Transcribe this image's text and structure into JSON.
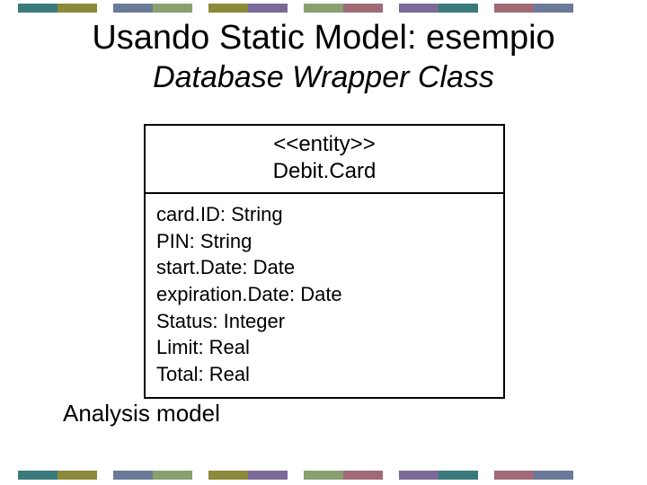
{
  "title": "Usando Static Model: esempio",
  "subtitle": "Database Wrapper Class",
  "uml": {
    "stereotype": "<<entity>>",
    "name": "Debit.Card",
    "attributes": [
      "card.ID: String",
      "PIN: String",
      "start.Date: Date",
      "expiration.Date: Date",
      "Status: Integer",
      "Limit: Real",
      "Total: Real"
    ]
  },
  "caption": "Analysis model"
}
